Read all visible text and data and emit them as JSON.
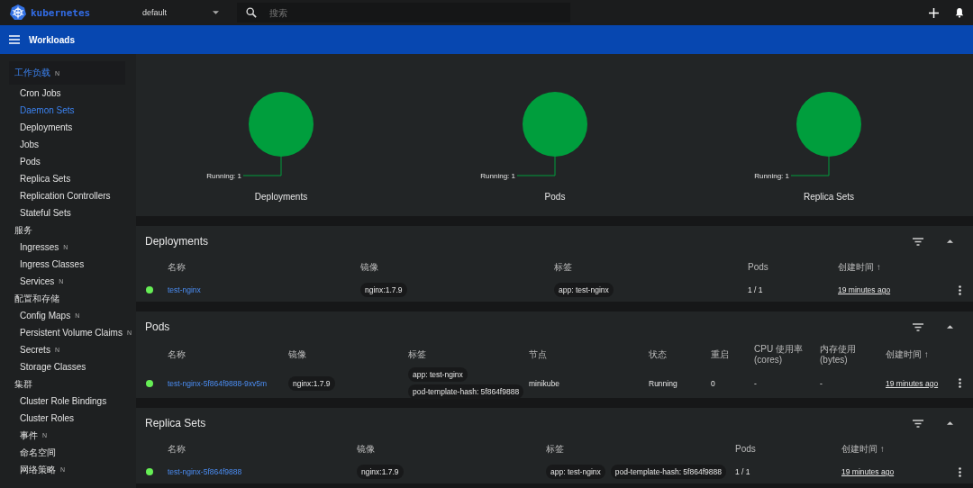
{
  "top_bar": {
    "logo_text": "kubernetes",
    "namespace": "default",
    "search": {
      "placeholder": "搜索"
    }
  },
  "title_bar": {
    "title": "Workloads"
  },
  "sidebar": {
    "sections": [
      {
        "label": "工作负载",
        "badge": "N",
        "selected": true,
        "items": [
          {
            "label": "Cron Jobs",
            "selected": false
          },
          {
            "label": "Daemon Sets",
            "selected": true
          },
          {
            "label": "Deployments",
            "selected": false
          },
          {
            "label": "Jobs",
            "selected": false
          },
          {
            "label": "Pods",
            "selected": false
          },
          {
            "label": "Replica Sets",
            "selected": false
          },
          {
            "label": "Replication Controllers",
            "selected": false
          },
          {
            "label": "Stateful Sets",
            "selected": false
          }
        ]
      },
      {
        "label": "服务",
        "selected": false,
        "items": [
          {
            "label": "Ingresses",
            "badge": "N",
            "selected": false
          },
          {
            "label": "Ingress Classes",
            "selected": false
          },
          {
            "label": "Services",
            "badge": "N",
            "selected": false
          }
        ]
      },
      {
        "label": "配置和存储",
        "selected": false,
        "items": [
          {
            "label": "Config Maps",
            "badge": "N",
            "selected": false
          },
          {
            "label": "Persistent Volume Claims",
            "badge": "N",
            "selected": false
          },
          {
            "label": "Secrets",
            "badge": "N",
            "selected": false
          },
          {
            "label": "Storage Classes",
            "selected": false
          }
        ]
      },
      {
        "label": "集群",
        "selected": false,
        "items": [
          {
            "label": "Cluster Role Bindings",
            "selected": false
          },
          {
            "label": "Cluster Roles",
            "selected": false
          },
          {
            "label": "事件",
            "badge": "N",
            "selected": false
          },
          {
            "label": "命名空间",
            "selected": false
          },
          {
            "label": "网络策略",
            "badge": "N",
            "selected": false
          }
        ]
      }
    ]
  },
  "charts": [
    {
      "title": "Deployments",
      "legend": "Running: 1"
    },
    {
      "title": "Pods",
      "legend": "Running: 1"
    },
    {
      "title": "Replica Sets",
      "legend": "Running: 1"
    }
  ],
  "tables": [
    {
      "kind": "deployments",
      "title": "Deployments",
      "columns": [
        "名称",
        "镜像",
        "标签",
        "Pods",
        "创建时间 ↑"
      ],
      "rows": [
        {
          "color": "#66ee55",
          "cells": [
            {
              "kind": "link",
              "text": "test-nginx"
            },
            {
              "kind": "chips",
              "chips": [
                "nginx:1.7.9"
              ]
            },
            {
              "kind": "chips",
              "chips": [
                "app: test-nginx"
              ]
            },
            {
              "kind": "text",
              "text": "1 / 1"
            },
            {
              "kind": "time",
              "text": "19 minutes ago"
            }
          ]
        }
      ]
    },
    {
      "kind": "pods",
      "title": "Pods",
      "columns": [
        "名称",
        "镜像",
        "标签",
        "节点",
        "状态",
        "重启",
        "CPU 使用率 (cores)",
        "内存使用 (bytes)",
        "创建时间 ↑"
      ],
      "rows": [
        {
          "color": "#66ee55",
          "cells": [
            {
              "kind": "link",
              "text": "test-nginx-5f864f9888-9xv5m"
            },
            {
              "kind": "chips",
              "chips": [
                "nginx:1.7.9"
              ]
            },
            {
              "kind": "stack",
              "chips": [
                "app: test-nginx",
                "pod-template-hash: 5f864f9888"
              ]
            },
            {
              "kind": "text",
              "text": "minikube"
            },
            {
              "kind": "text",
              "text": "Running"
            },
            {
              "kind": "text",
              "text": "0"
            },
            {
              "kind": "text",
              "text": "-"
            },
            {
              "kind": "text",
              "text": "-"
            },
            {
              "kind": "time",
              "text": "19 minutes ago"
            }
          ]
        }
      ]
    },
    {
      "kind": "replicasets",
      "title": "Replica Sets",
      "columns": [
        "名称",
        "镜像",
        "标签",
        "Pods",
        "创建时间 ↑"
      ],
      "rows": [
        {
          "color": "#66ee55",
          "cells": [
            {
              "kind": "link",
              "text": "test-nginx-5f864f9888"
            },
            {
              "kind": "chips",
              "chips": [
                "nginx:1.7.9"
              ]
            },
            {
              "kind": "chips",
              "chips": [
                "app: test-nginx",
                "pod-template-hash: 5f864f9888"
              ]
            },
            {
              "kind": "text",
              "text": "1 / 1"
            },
            {
              "kind": "time",
              "text": "19 minutes ago"
            }
          ]
        }
      ]
    }
  ]
}
